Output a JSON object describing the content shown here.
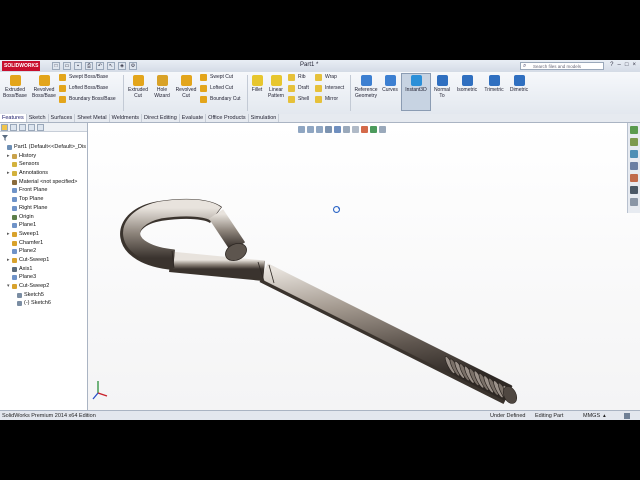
{
  "app": {
    "logo_text": "SOLIDWORKS",
    "document_title": "Part1 *",
    "search_placeholder": "Search files and models",
    "window_controls": [
      "?",
      "–",
      "□",
      "×"
    ]
  },
  "quick_access": [
    "new",
    "open",
    "save",
    "print",
    "undo",
    "select",
    "rebuild",
    "options"
  ],
  "ribbon": {
    "large_buttons": [
      {
        "id": "extruded-boss",
        "label1": "Extruded",
        "label2": "Boss/Base",
        "color": "#e3a51b"
      },
      {
        "id": "revolved-boss",
        "label1": "Revolved",
        "label2": "Boss/Base",
        "color": "#e3a51b"
      },
      {
        "id": "extruded-cut",
        "label1": "Extruded",
        "label2": "Cut",
        "color": "#e3a51b"
      },
      {
        "id": "hole-wizard",
        "label1": "Hole",
        "label2": "Wizard",
        "color": "#d9a227"
      },
      {
        "id": "revolved-cut",
        "label1": "Revolved",
        "label2": "Cut",
        "color": "#e3a51b"
      },
      {
        "id": "fillet",
        "label1": "Fillet",
        "label2": "",
        "color": "#e7c62e"
      },
      {
        "id": "linear-pattern",
        "label1": "Linear",
        "label2": "Pattern",
        "color": "#e7c62e"
      },
      {
        "id": "reference-geometry",
        "label1": "Reference",
        "label2": "Geometry",
        "color": "#3c7fd1"
      },
      {
        "id": "curves",
        "label1": "Curves",
        "label2": "",
        "color": "#3c7fd1"
      },
      {
        "id": "instant3d",
        "label1": "Instant3D",
        "label2": "",
        "color": "#2a8fd8"
      },
      {
        "id": "normal-to",
        "label1": "Normal",
        "label2": "To",
        "color": "#2f6fc0"
      },
      {
        "id": "isometric",
        "label1": "Isometric",
        "label2": "",
        "color": "#2f6fc0"
      },
      {
        "id": "trimetric",
        "label1": "Trimetric",
        "label2": "",
        "color": "#2f6fc0"
      },
      {
        "id": "dimetric",
        "label1": "Dimetric",
        "label2": "",
        "color": "#2f6fc0"
      }
    ],
    "small_boss": [
      "Swept Boss/Base",
      "Lofted Boss/Base",
      "Boundary Boss/Base"
    ],
    "small_cut": [
      "Swept Cut",
      "Lofted Cut",
      "Boundary Cut"
    ],
    "small_features_a": [
      "Rib",
      "Draft",
      "Shell"
    ],
    "small_features_b": [
      "Wrap",
      "Intersect",
      "Mirror"
    ]
  },
  "tabs": [
    "Features",
    "Sketch",
    "Surfaces",
    "Sheet Metal",
    "Weldments",
    "Direct Editing",
    "Evaluate",
    "Office Products",
    "Simulation"
  ],
  "tree": [
    {
      "label": "Part1  (Default<<Default>_Dis",
      "indent": 0,
      "icon": "#6d8fb5",
      "exp": ""
    },
    {
      "label": "History",
      "indent": 1,
      "icon": "#c9a24a",
      "exp": "▸"
    },
    {
      "label": "Sensors",
      "indent": 1,
      "icon": "#d3b23d",
      "exp": ""
    },
    {
      "label": "Annotations",
      "indent": 1,
      "icon": "#d3b23d",
      "exp": "▸"
    },
    {
      "label": "Material <not specified>",
      "indent": 1,
      "icon": "#8a6b3b",
      "exp": ""
    },
    {
      "label": "Front Plane",
      "indent": 1,
      "icon": "#6f93c8",
      "exp": ""
    },
    {
      "label": "Top Plane",
      "indent": 1,
      "icon": "#6f93c8",
      "exp": ""
    },
    {
      "label": "Right Plane",
      "indent": 1,
      "icon": "#6f93c8",
      "exp": ""
    },
    {
      "label": "Origin",
      "indent": 1,
      "icon": "#5d7f4a",
      "exp": ""
    },
    {
      "label": "Plane1",
      "indent": 1,
      "icon": "#6f93c8",
      "exp": ""
    },
    {
      "label": "Sweep1",
      "indent": 1,
      "icon": "#d8a22c",
      "exp": "▸"
    },
    {
      "label": "Chamfer1",
      "indent": 1,
      "icon": "#d8a22c",
      "exp": ""
    },
    {
      "label": "Plane2",
      "indent": 1,
      "icon": "#6f93c8",
      "exp": ""
    },
    {
      "label": "Cut-Sweep1",
      "indent": 1,
      "icon": "#d8a22c",
      "exp": "▸"
    },
    {
      "label": "Axis1",
      "indent": 1,
      "icon": "#5b6b7a",
      "exp": ""
    },
    {
      "label": "Plane3",
      "indent": 1,
      "icon": "#6f93c8",
      "exp": ""
    },
    {
      "label": "Cut-Sweep2",
      "indent": 1,
      "icon": "#d8a22c",
      "exp": "▾"
    },
    {
      "label": "Sketch5",
      "indent": 2,
      "icon": "#7a8da3",
      "exp": ""
    },
    {
      "label": "(-) Sketch6",
      "indent": 2,
      "icon": "#7a8da3",
      "exp": ""
    }
  ],
  "status": {
    "edition": "SolidWorks Premium 2014 x64 Edition",
    "definition": "Under Defined",
    "mode": "Editing Part",
    "units": "MMGS",
    "units_arrow": "▴"
  }
}
